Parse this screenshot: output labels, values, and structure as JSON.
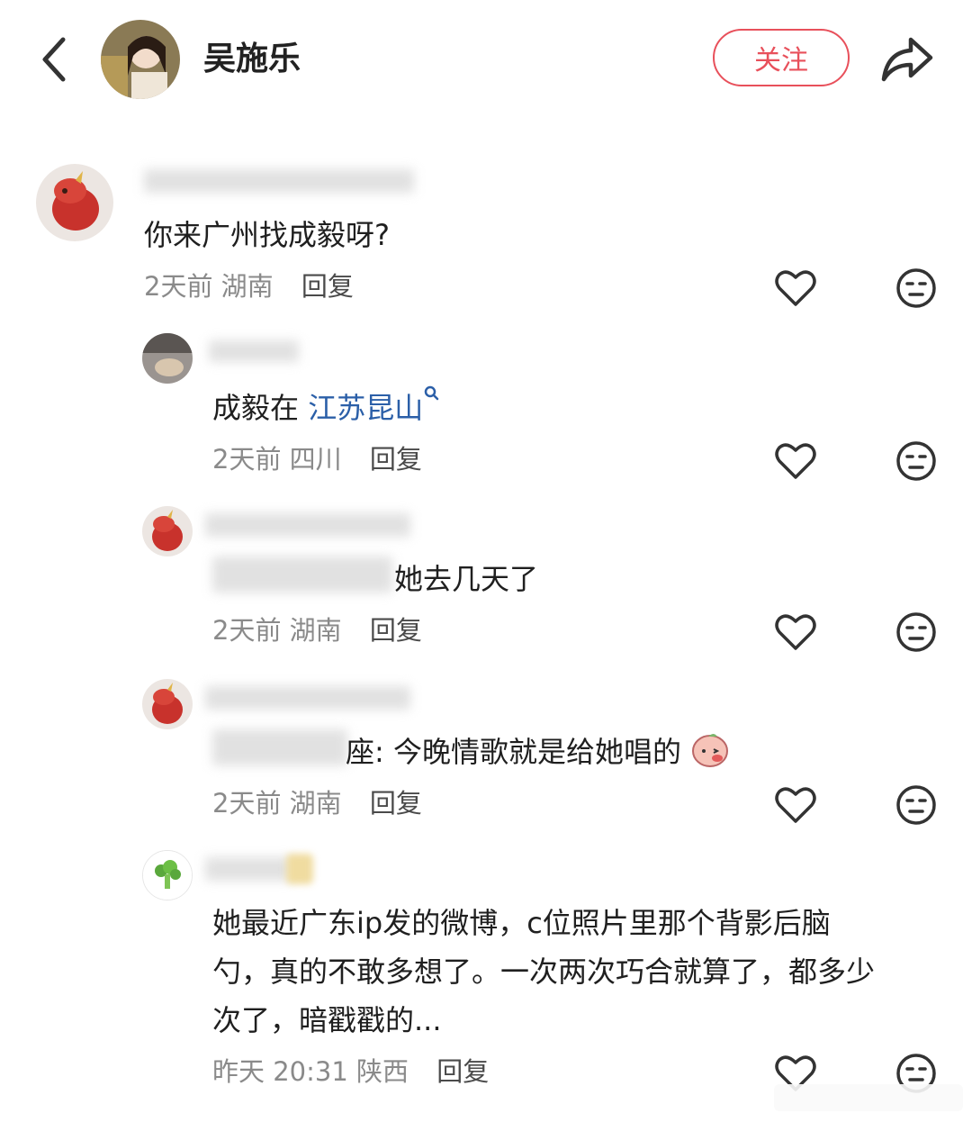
{
  "header": {
    "name": "吴施乐",
    "follow_label": "关注"
  },
  "comments": [
    {
      "text": "你来广州找成毅呀?",
      "time": "2天前",
      "location": "湖南",
      "reply": "回复"
    },
    {
      "text_prefix": "成毅在 ",
      "link": "江苏昆山",
      "time": "2天前",
      "location": "四川",
      "reply": "回复"
    },
    {
      "text": "她去几天了",
      "time": "2天前",
      "location": "湖南",
      "reply": "回复"
    },
    {
      "text": "座: 今晚情歌就是给她唱的",
      "time": "2天前",
      "location": "湖南",
      "reply": "回复"
    },
    {
      "lines": [
        "她最近广东ip发的微博，c位照片里那个背影后脑",
        "勺，真的不敢多想了。一次两次巧合就算了，都多少",
        "次了，暗戳戳的..."
      ],
      "time": "昨天 20:31",
      "location": "陕西",
      "reply": "回复"
    }
  ],
  "colors": {
    "accent": "#e8505b",
    "link": "#2b5fa8"
  }
}
